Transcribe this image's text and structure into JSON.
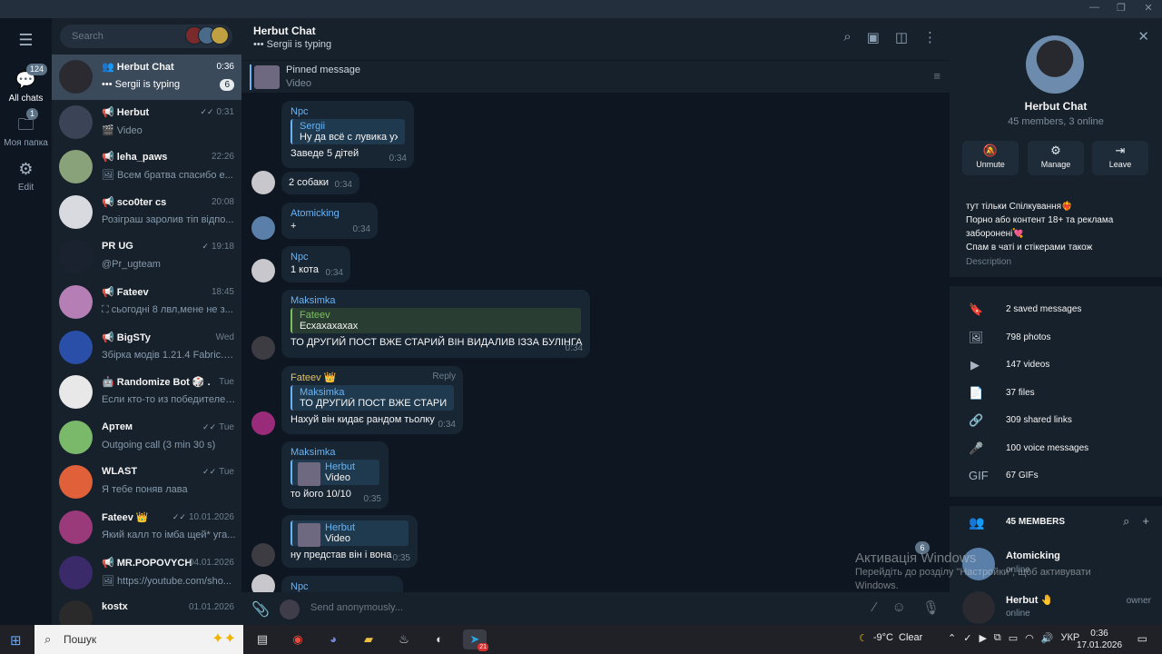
{
  "window": {
    "controls": [
      "—",
      "❐",
      "✕"
    ]
  },
  "rail": {
    "items": [
      {
        "label": "",
        "icon": "menu-icon",
        "glyph": "☰"
      },
      {
        "label": "All chats",
        "icon": "chats-icon",
        "glyph": "💬",
        "badge": "124"
      },
      {
        "label": "Моя папка",
        "icon": "folder-icon",
        "glyph": "🗀",
        "badge": "1"
      },
      {
        "label": "Edit",
        "icon": "edit-filters-icon",
        "glyph": "⚙"
      }
    ]
  },
  "search": {
    "placeholder": "Search"
  },
  "chats": [
    {
      "name": "Herbut Chat",
      "prefix": "👥",
      "time": "0:36",
      "preview": "••• Sergii is typing",
      "badge": "6",
      "active": true,
      "color": "#2a2a30"
    },
    {
      "name": "Herbut",
      "prefix": "📢",
      "time": "0:31",
      "preview": "🎬 Video",
      "check": "✓✓",
      "color": "#3a4456"
    },
    {
      "name": "leha_paws",
      "prefix": "📢",
      "time": "22:26",
      "preview": "🖼 Всем братва спасибо е...",
      "color": "#8aa27a"
    },
    {
      "name": "sco0ter cs",
      "prefix": "📢",
      "time": "20:08",
      "preview": "Розіграш заролив тіп відпо...",
      "color": "#d9d9e0"
    },
    {
      "name": "PR UG",
      "prefix": "",
      "time": "19:18",
      "preview": "@Pr_ugteam",
      "check": "✓",
      "color": "#1a2230"
    },
    {
      "name": "Fateev",
      "prefix": "📢",
      "time": "18:45",
      "preview": "⛶ сьогодні 8 лвл,мене не з...",
      "color": "#b57fb5"
    },
    {
      "name": "BigSTy",
      "prefix": "📢",
      "time": "Wed",
      "preview": "Збірка модів 1.21.4 Fabric.ra...",
      "color": "#2a4fa8"
    },
    {
      "name": "Randomize Bot 🎲 ...",
      "prefix": "🤖",
      "time": "Tue",
      "preview": "Если кто-то из победителей...",
      "color": "#e8e8e8"
    },
    {
      "name": "Артем",
      "prefix": "",
      "time": "Tue",
      "preview": "Outgoing call (3 min 30 s)",
      "check": "✓✓",
      "color": "#7ab86a"
    },
    {
      "name": "WLAST",
      "prefix": "",
      "time": "Tue",
      "preview": "Я тебе поняв лава",
      "check": "✓✓",
      "color": "#e0603a"
    },
    {
      "name": "Fateev 👑",
      "prefix": "",
      "time": "10.01.2026",
      "preview": "Який калл то імба щей* уга...",
      "check": "✓✓",
      "color": "#9a3a7a"
    },
    {
      "name": "MR.POPOVYCH",
      "prefix": "📢",
      "time": "04.01.2026",
      "preview": "🖼 https://youtube.com/sho...",
      "color": "#3a2a6a"
    },
    {
      "name": "kostx",
      "prefix": "",
      "time": "01.01.2026",
      "preview": "",
      "color": "#2a2a2a"
    }
  ],
  "header": {
    "title": "Herbut Chat",
    "subtitle": "••• Sergii is typing",
    "icons": [
      "search-icon",
      "video-chat-icon",
      "sidebar-toggle-icon",
      "more-icon"
    ]
  },
  "pinned": {
    "title": "Pinned message",
    "subtitle": "Video"
  },
  "messages": [
    {
      "sender": "Npc",
      "senderColor": "#6ab3f3",
      "quoteName": "Sergii",
      "quoteText": "Ну да всё с лувика ух...",
      "text": "Заведе 5 дітей",
      "time": "0:34"
    },
    {
      "sender": "",
      "text": "2 собаки",
      "time": "0:34"
    },
    {
      "sender": "Atomicking",
      "senderColor": "#6ab3f3",
      "text": "+",
      "time": "0:34"
    },
    {
      "sender": "Npc",
      "senderColor": "#6ab3f3",
      "text": "1 кота",
      "time": "0:34"
    },
    {
      "sender": "Maksimka",
      "senderColor": "#6ab3f3",
      "quoteName": "Fateev",
      "quoteText": "Есхахахахах",
      "text": "ТО ДРУГИЙ ПОСТ ВЖЕ СТАРИЙ ВІН ВИДАЛИВ ІЗЗА БУЛІНГА",
      "time": "0:34"
    },
    {
      "sender": "Fateev 👑",
      "senderColor": "#6ac0b0",
      "reply": "Reply",
      "quoteName": "Maksimka",
      "quoteText": "ТО ДРУГИЙ ПОСТ ВЖЕ СТАРИЙ В...",
      "text": "Нахуй він кидає рандом тьолку",
      "time": "0:34"
    },
    {
      "sender": "Maksimka",
      "senderColor": "#6ab3f3",
      "quoteName": "Herbut",
      "quoteText": "Video",
      "text": "то його 10/10",
      "time": "0:35"
    },
    {
      "sender": "",
      "quoteName": "Herbut",
      "quoteText": "Video",
      "text": "ну представ він і вона",
      "time": "0:35"
    },
    {
      "sender": "Npc",
      "senderColor": "#6ab3f3",
      "text": "",
      "time": ""
    }
  ],
  "composer": {
    "placeholder": "Send anonymously..."
  },
  "scroll_badge": "6",
  "info": {
    "title": "Herbut Chat",
    "subtitle": "45 members, 3 online",
    "actions": [
      {
        "label": "Unmute",
        "glyph": "🔕"
      },
      {
        "label": "Manage",
        "glyph": "⚙"
      },
      {
        "label": "Leave",
        "glyph": "⇥"
      }
    ],
    "description_lines": [
      "тут тільки Спілкування❤️‍🔥",
      "Порно або контент 18+ та реклама",
      "заборонені💘",
      "Спам в чаті и стікерами також"
    ],
    "description_label": "Description",
    "media": [
      {
        "label": "2 saved messages",
        "glyph": "🔖"
      },
      {
        "label": "798 photos",
        "glyph": "🖼"
      },
      {
        "label": "147 videos",
        "glyph": "▶"
      },
      {
        "label": "37 files",
        "glyph": "📄"
      },
      {
        "label": "309 shared links",
        "glyph": "🔗"
      },
      {
        "label": "100 voice messages",
        "glyph": "🎤"
      },
      {
        "label": "67 GIFs",
        "glyph": "GIF"
      }
    ],
    "members_header": "45 MEMBERS",
    "members": [
      {
        "name": "Atomicking",
        "status": "online",
        "role": "",
        "color": "#5a7fa8"
      },
      {
        "name": "Herbut 🤚",
        "status": "online",
        "role": "owner",
        "color": "#2a2a30"
      }
    ]
  },
  "activation": {
    "title": "Активація Windows",
    "text": "Перейдіть до розділу \"Настройки\", щоб активувати Windows."
  },
  "taskbar": {
    "search_text": "Пошук",
    "weather_temp": "-9°C",
    "weather_text": "Clear",
    "lang": "УКР",
    "time": "0:36",
    "date": "17.01.2026",
    "tg_badge": "21"
  }
}
